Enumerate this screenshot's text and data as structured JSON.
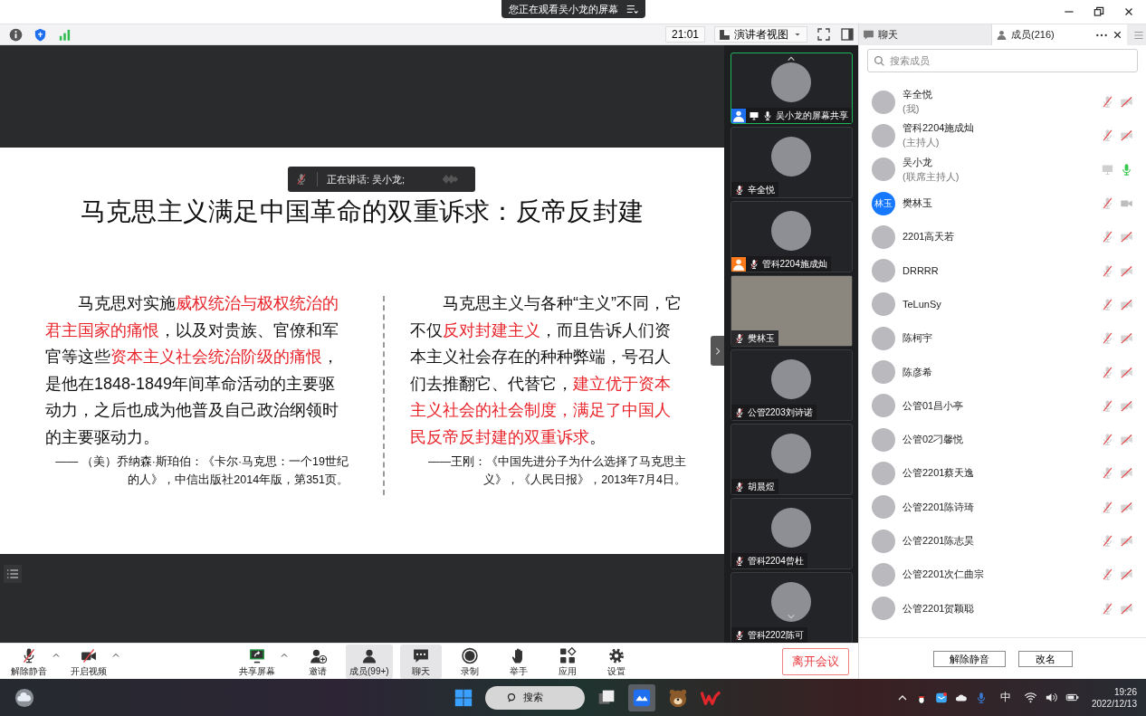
{
  "title_bar": {
    "share_notice": "您正在观看吴小龙的屏幕"
  },
  "toolbar": {
    "time": "21:01",
    "view_mode": "演讲者视图"
  },
  "panel_tabs": [
    {
      "label": "聊天",
      "kind": "chat",
      "selected": false
    },
    {
      "label": "成员(216)",
      "kind": "members",
      "selected": true
    }
  ],
  "slide": {
    "title": "马克思主义满足中国革命的双重诉求：反帝反封建",
    "columns": [
      {
        "paragraph": [
          {
            "text": "马克思对实施",
            "highlight": false
          },
          {
            "text": "威权统治与极权统治的君主国家的痛恨",
            "highlight": true
          },
          {
            "text": "，以及对贵族、官僚和军官等这些",
            "highlight": false
          },
          {
            "text": "资本主义社会统治阶级的痛恨",
            "highlight": true
          },
          {
            "text": "，是他在1848-1849年间革命活动的主要驱动力，之后也成为他普及自己政治纲领时的主要驱动力。",
            "highlight": false
          }
        ],
        "citation": "—— （美）乔纳森·斯珀伯：《卡尔·马克思：一个19世纪的人》，中信出版社2014年版，第351页。"
      },
      {
        "paragraph": [
          {
            "text": "马克思主义与各种“主义”不同，它不仅",
            "highlight": false
          },
          {
            "text": "反对封建主义",
            "highlight": true
          },
          {
            "text": "，而且告诉人们资本主义社会存在的种种弊端，号召人们去推翻它、代替它，",
            "highlight": false
          },
          {
            "text": "建立优于资本主义社会的社会制度，满足了中国人民反帝反封建的双重诉求",
            "highlight": true
          },
          {
            "text": "。",
            "highlight": false
          }
        ],
        "citation": "——王刚：《中国先进分子为什么选择了马克思主义》，《人民日报》，2013年7月4日。"
      }
    ]
  },
  "speaking": {
    "label": "正在讲话: 吴小龙;"
  },
  "video_tiles": [
    {
      "name": "吴小龙的屏幕共享",
      "kind": "avatar",
      "color": "#1e6ff0",
      "sharing": true,
      "muted": false,
      "selected": true
    },
    {
      "name": "辛全悦",
      "kind": "avatar",
      "sharing": false,
      "muted": true,
      "selected": false
    },
    {
      "name": "管科2204施成灿",
      "kind": "avatar",
      "color": "#ff7a1a",
      "sharing": false,
      "muted": true,
      "selected": false
    },
    {
      "name": "樊林玉",
      "kind": "video",
      "sharing": false,
      "muted": true,
      "selected": false
    },
    {
      "name": "公管2203刘诗诺",
      "kind": "avatar",
      "sharing": false,
      "muted": true,
      "selected": false
    },
    {
      "name": "胡晨煜",
      "kind": "avatar",
      "sharing": false,
      "muted": true,
      "selected": false
    },
    {
      "name": "管科2204曾杜",
      "kind": "avatar",
      "sharing": false,
      "muted": true,
      "selected": false
    },
    {
      "name": "管科2202陈可",
      "kind": "avatar",
      "sharing": false,
      "muted": true,
      "selected": false
    }
  ],
  "members": {
    "search": {
      "placeholder": "搜索成员"
    },
    "list": [
      {
        "name": "辛全悦",
        "role": "(我)",
        "muted": true,
        "video_off": true,
        "sharing": false
      },
      {
        "name": "管科2204施成灿",
        "role": "(主持人)",
        "muted": true,
        "video_off": true,
        "sharing": false
      },
      {
        "name": "吴小龙",
        "role": "(联席主持人)",
        "muted": false,
        "sharing": true
      },
      {
        "name": "樊林玉",
        "avatar_text": "林玉",
        "muted": true,
        "video_off": false,
        "sharing": false
      },
      {
        "name": "2201高天若",
        "muted": true,
        "video_off": true,
        "sharing": false
      },
      {
        "name": "DRRRR",
        "muted": true,
        "video_off": true,
        "sharing": false
      },
      {
        "name": "TeLunSy",
        "muted": true,
        "video_off": true,
        "sharing": false
      },
      {
        "name": "陈柯宇",
        "muted": true,
        "video_off": true,
        "sharing": false
      },
      {
        "name": "陈彦希",
        "muted": true,
        "video_off": true,
        "sharing": false
      },
      {
        "name": "公管01昌小亭",
        "muted": true,
        "video_off": true,
        "sharing": false
      },
      {
        "name": "公管02刁馨悦",
        "muted": true,
        "video_off": true,
        "sharing": false
      },
      {
        "name": "公管2201蔡天逸",
        "muted": true,
        "video_off": true,
        "sharing": false
      },
      {
        "name": "公管2201陈诗琦",
        "muted": true,
        "video_off": true,
        "sharing": false
      },
      {
        "name": "公管2201陈志昊",
        "muted": true,
        "video_off": true,
        "sharing": false
      },
      {
        "name": "公管2201次仁曲宗",
        "muted": true,
        "video_off": true,
        "sharing": false
      },
      {
        "name": "公管2201贺颖聪",
        "muted": true,
        "video_off": true,
        "sharing": false
      }
    ],
    "buttons": [
      "解除静音",
      "改名"
    ]
  },
  "controls": [
    {
      "label": "解除静音",
      "kind": "mic_off",
      "menu": true,
      "selected": false
    },
    {
      "label": "开启视频",
      "kind": "video_off",
      "menu": true,
      "selected": false
    },
    {
      "label": "共享屏幕",
      "kind": "share",
      "menu": true,
      "selected": false
    },
    {
      "label": "邀请",
      "kind": "invite",
      "menu": false,
      "selected": false
    },
    {
      "label": "成员(99+)",
      "kind": "members",
      "menu": false,
      "selected": true
    },
    {
      "label": "聊天",
      "kind": "chat",
      "menu": false,
      "selected": true
    },
    {
      "label": "录制",
      "kind": "record",
      "menu": false,
      "selected": false
    },
    {
      "label": "举手",
      "kind": "hand",
      "menu": false,
      "selected": false
    },
    {
      "label": "应用",
      "kind": "apps",
      "menu": false,
      "selected": false
    },
    {
      "label": "设置",
      "kind": "settings",
      "menu": false,
      "selected": false
    }
  ],
  "leave_button": "离开会议",
  "taskbar": {
    "search": "搜索",
    "input_method": "中",
    "time": "19:26",
    "date": "2022/12/13"
  }
}
